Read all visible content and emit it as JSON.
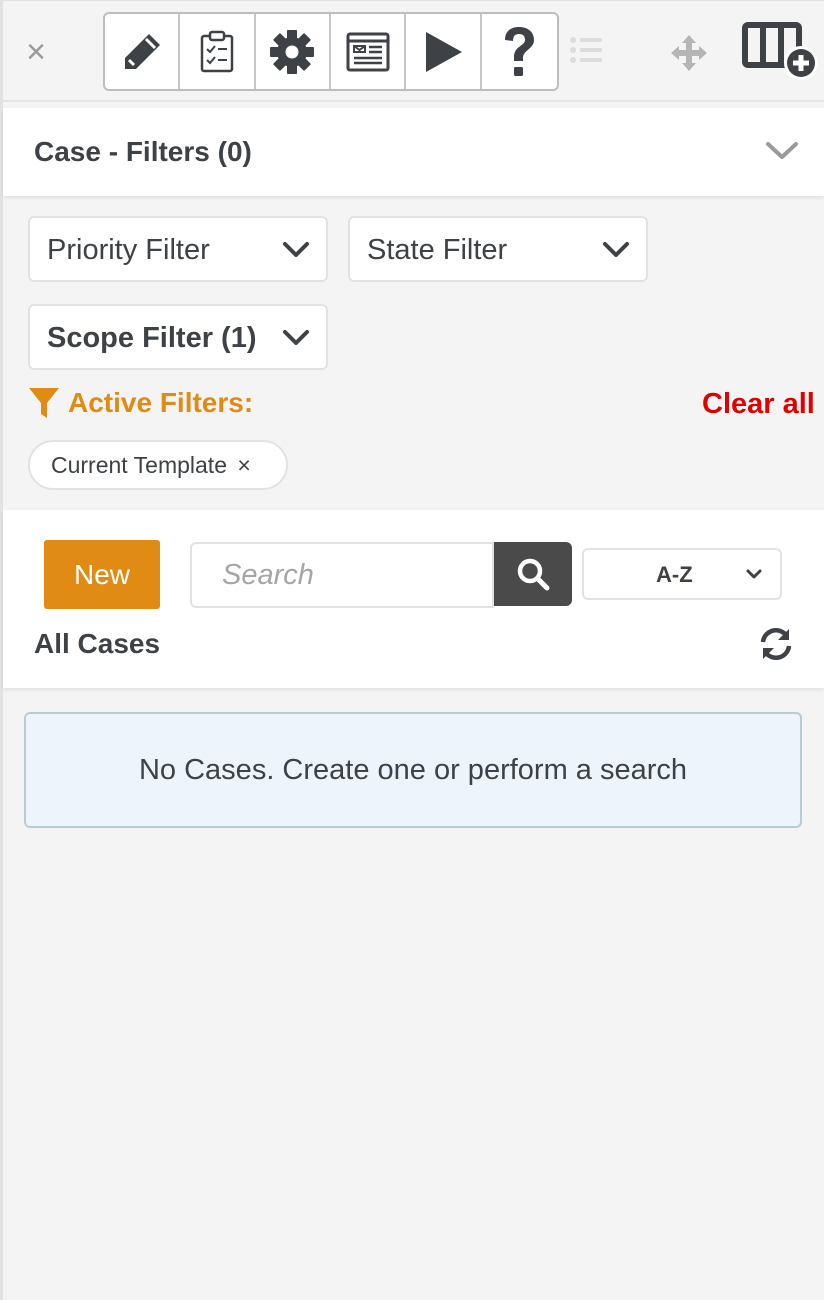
{
  "toolbar": {
    "close_symbol": "×",
    "buttons": [
      {
        "icon": "pencil-icon"
      },
      {
        "icon": "clipboard-checklist-icon"
      },
      {
        "icon": "gear-icon"
      },
      {
        "icon": "document-list-icon"
      },
      {
        "icon": "play-icon"
      },
      {
        "icon": "question-icon"
      }
    ],
    "extra_icons": [
      "list-icon",
      "move-icon",
      "layout-add-icon"
    ],
    "colors": {
      "icon_dark": "#3e4246",
      "icon_muted": "#b5b5b5"
    }
  },
  "filters": {
    "title": "Case - Filters (0)",
    "dropdowns": {
      "priority": "Priority Filter",
      "state": "State Filter",
      "scope": "Scope Filter (1)"
    },
    "active_label": "Active Filters:",
    "clear_all": "Clear all",
    "chips": [
      {
        "label": "Current Template",
        "remove_symbol": "×"
      }
    ],
    "colors": {
      "active": "#e08b14",
      "clear_all": "#e00000"
    }
  },
  "cases": {
    "new_button": "New",
    "search_placeholder": "Search",
    "sort_value": "A-Z",
    "list_title": "All Cases",
    "empty_message": "No Cases. Create one or perform a search",
    "colors": {
      "new_button": "#e08b14",
      "search_button": "#4a4a4a",
      "empty_bg": "#edf4fc"
    }
  }
}
